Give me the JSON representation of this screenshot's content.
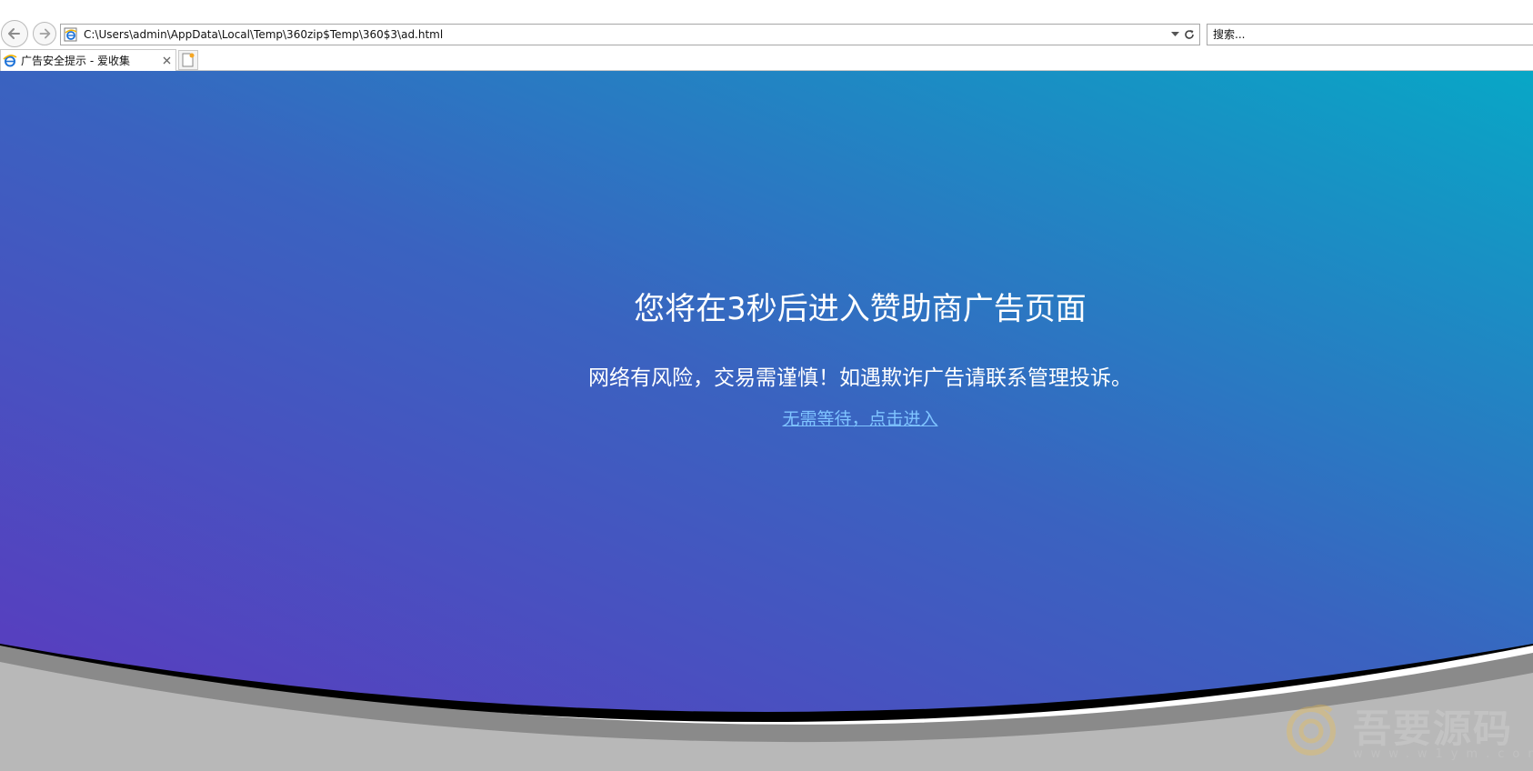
{
  "browser": {
    "address_url": "C:\\Users\\admin\\AppData\\Local\\Temp\\360zip$Temp\\360$3\\ad.html",
    "search_placeholder": "搜索...",
    "tab_title": "广告安全提示 - 爱收集"
  },
  "page": {
    "headline": "您将在3秒后进入赞助商广告页面",
    "warning": "网络有风险，交易需谨慎！如遇欺诈广告请联系管理投诉。",
    "skip_link": "无需等待，点击进入"
  },
  "watermark": {
    "title": "吾要源码",
    "url": "www.w1ym.com"
  },
  "colors": {
    "gradient_start": "#5a3bbf",
    "gradient_mid": "#3a63c0",
    "gradient_end": "#08a7c6",
    "wave_dark": "#000000",
    "wave_gray": "#8a8a8a",
    "wave_light": "#b8b8b8",
    "link": "#7fc4ff"
  },
  "icons": {
    "back": "back-arrow-icon",
    "forward": "forward-arrow-icon",
    "page": "ie-page-icon",
    "dropdown": "chevron-down-icon",
    "refresh": "refresh-icon",
    "tab_close": "close-icon",
    "new_tab": "new-tab-icon"
  }
}
